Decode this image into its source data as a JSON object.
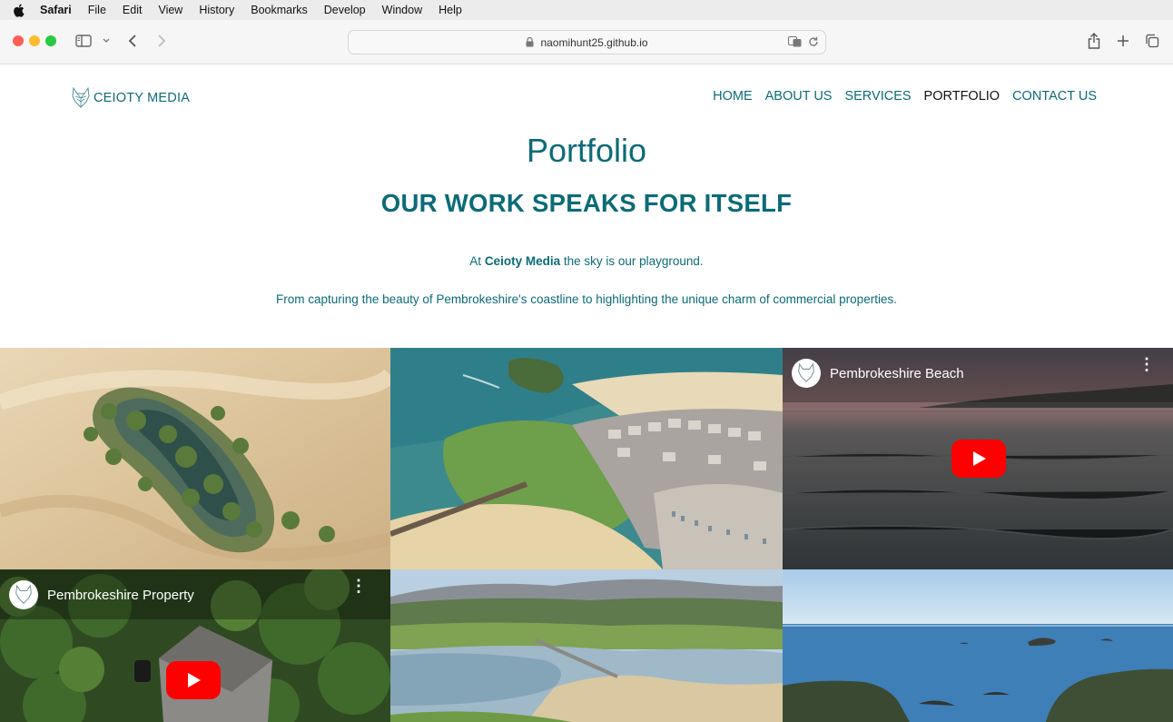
{
  "menubar": {
    "items": [
      "Safari",
      "File",
      "Edit",
      "View",
      "History",
      "Bookmarks",
      "Develop",
      "Window",
      "Help"
    ]
  },
  "browser": {
    "url": "naomihunt25.github.io"
  },
  "site": {
    "brand": "CEIOTY MEDIA",
    "nav": [
      "HOME",
      "ABOUT US",
      "SERVICES",
      "PORTFOLIO",
      "CONTACT US"
    ],
    "active_nav": "PORTFOLIO",
    "title": "Portfolio",
    "subtitle": "OUR WORK SPEAKS FOR ITSELF",
    "intro_prefix": "At ",
    "intro_brand": "Ceioty Media",
    "intro_suffix": " the sky is our playground.",
    "intro2": "From capturing the beauty of Pembrokeshire's coastline to highlighting the unique charm of commercial properties."
  },
  "gallery": {
    "videos": [
      {
        "title": "Pembrokeshire Beach"
      },
      {
        "title": "Pembrokeshire Property"
      }
    ]
  },
  "colors": {
    "brand_teal": "#0c6b77",
    "youtube_red": "#ff0000"
  }
}
